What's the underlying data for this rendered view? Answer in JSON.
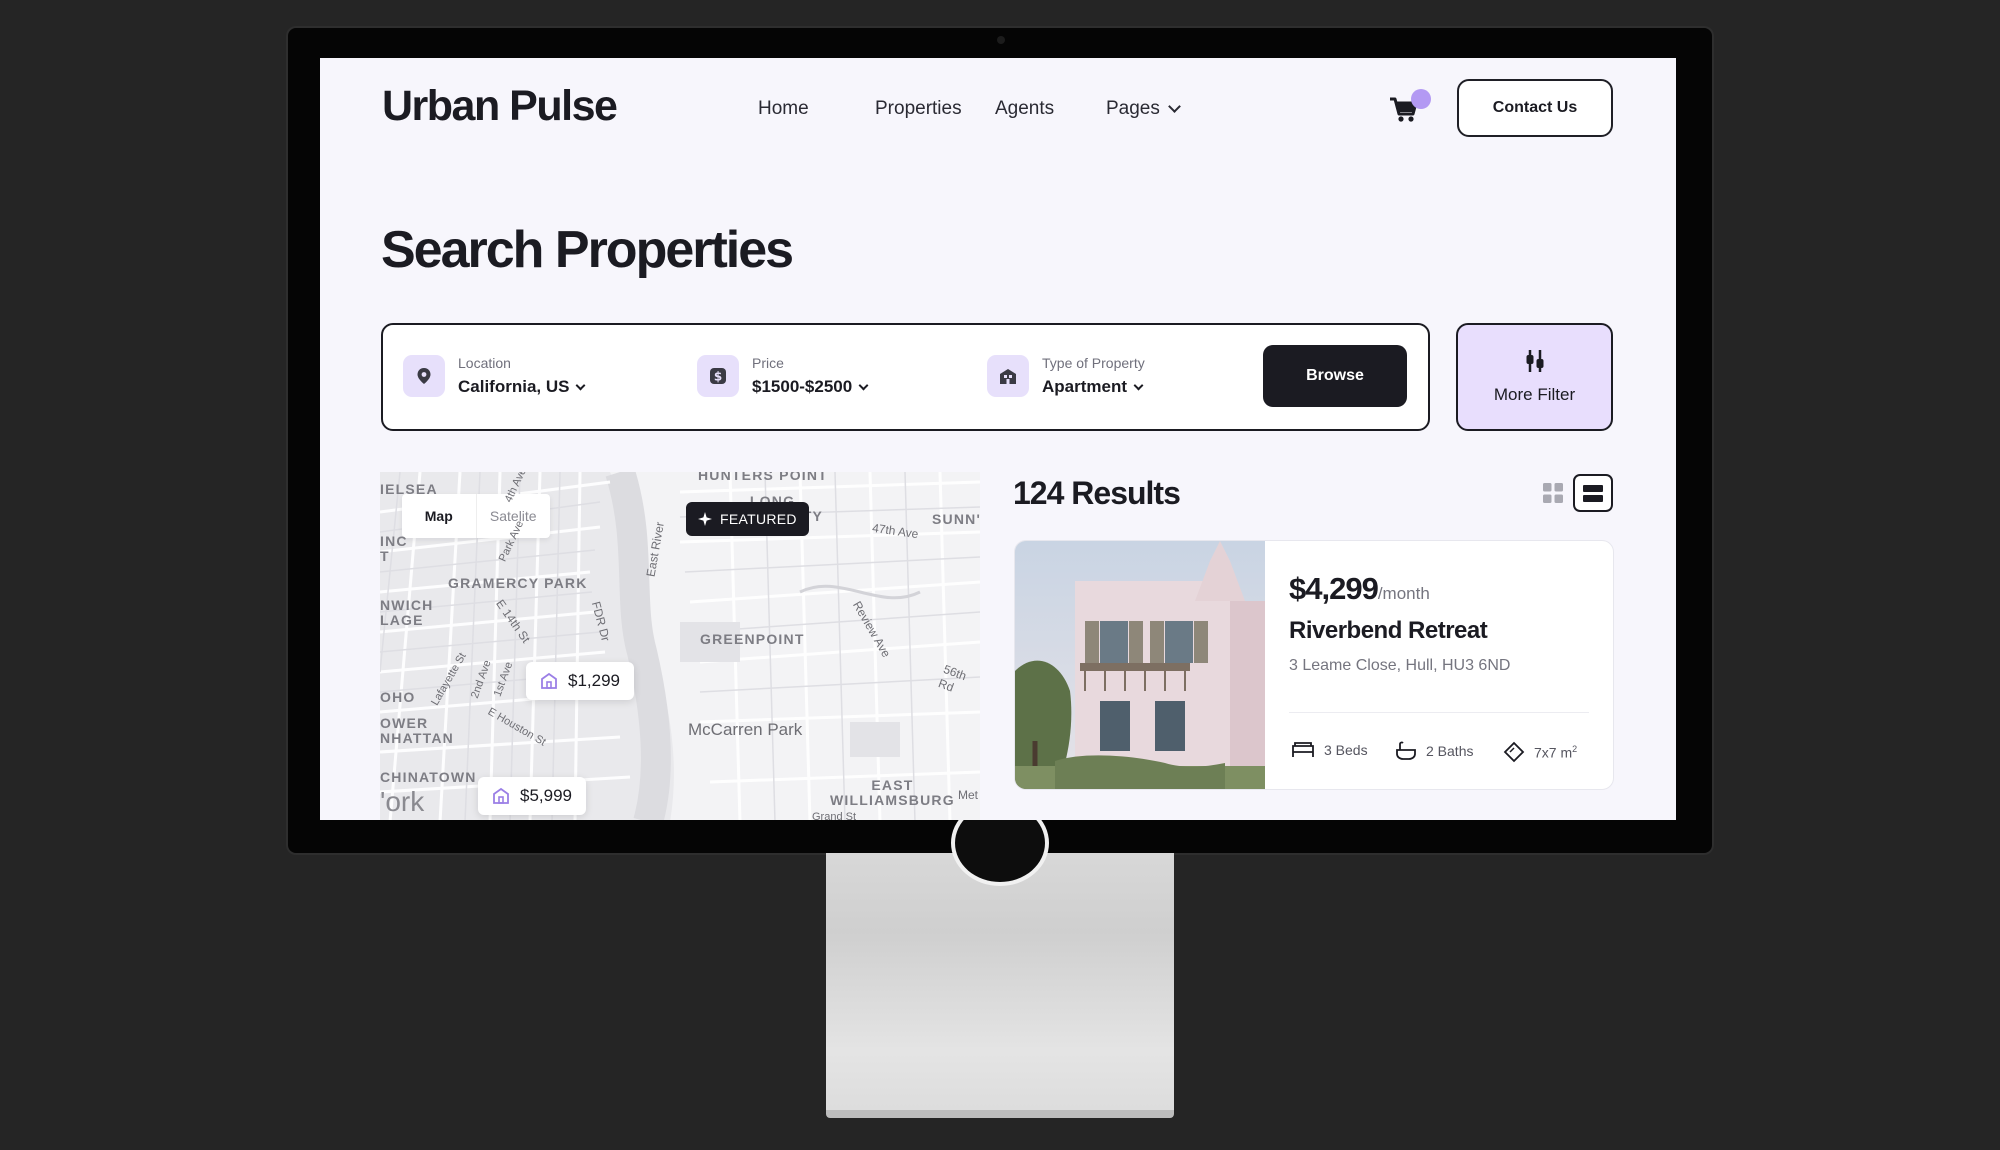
{
  "brand": {
    "name": "Urban Pulse"
  },
  "nav": {
    "home": "Home",
    "properties": "Properties",
    "agents": "Agents",
    "pages": "Pages"
  },
  "header": {
    "contact_label": "Contact Us"
  },
  "page": {
    "title": "Search Properties"
  },
  "search": {
    "location_label": "Location",
    "location_value": "California, US",
    "price_label": "Price",
    "price_value": "$1500-$2500",
    "type_label": "Type of Property",
    "type_value": "Apartment",
    "browse_label": "Browse",
    "more_filter_label": "More Filter"
  },
  "map": {
    "tab_map": "Map",
    "tab_satellite": "Satelite",
    "labels": {
      "chelsea": "IELSEA",
      "hunters_point": "HUNTERS POINT",
      "long_island_city": "LONG\nISLAND CITY",
      "sunnyside": "SUNN'",
      "gramercy": "GRAMERCY PARK",
      "greenwich": "NWICH\nLAGE",
      "inc": "INC\nT",
      "greenpoint": "GREENPOINT",
      "soho": "OHO",
      "lower_manhattan": "OWER\nNHATTAN",
      "mccarren": "McCarren Park",
      "chinatown": "CHINATOWN",
      "york": "'ork",
      "east_williamsburg": "EAST\nWILLIAMSBURG",
      "met": "Met",
      "street_47th": "47th Ave",
      "street_e14": "E 14th St",
      "street_fdr": "FDR Dr",
      "street_east_river": "East River",
      "street_review": "Review Ave",
      "street_56th": "56th Rd",
      "street_lafayette": "Lafayette St",
      "street_2nd": "2nd Ave",
      "street_1st": "1st Ave",
      "street_houston": "E Houston St",
      "street_park": "Park Ave",
      "street_4th": "4th Ave",
      "street_grand": "Grand St"
    },
    "pins": [
      {
        "price": "$1,299"
      },
      {
        "price": "$5,999"
      }
    ]
  },
  "results": {
    "count_label": "124 Results",
    "listing": {
      "badge": "FEATURED",
      "price": "$4,299",
      "price_unit": "/month",
      "name": "Riverbend Retreat",
      "address": "3 Leame Close, Hull, HU3 6ND",
      "beds": "3 Beds",
      "baths": "2 Baths",
      "area": "7x7 m",
      "area_sup": "2"
    }
  },
  "colors": {
    "accent": "#b399f3",
    "accent_light": "#e8defd",
    "dark": "#1b1b22",
    "screen_bg": "#f7f6fc"
  }
}
